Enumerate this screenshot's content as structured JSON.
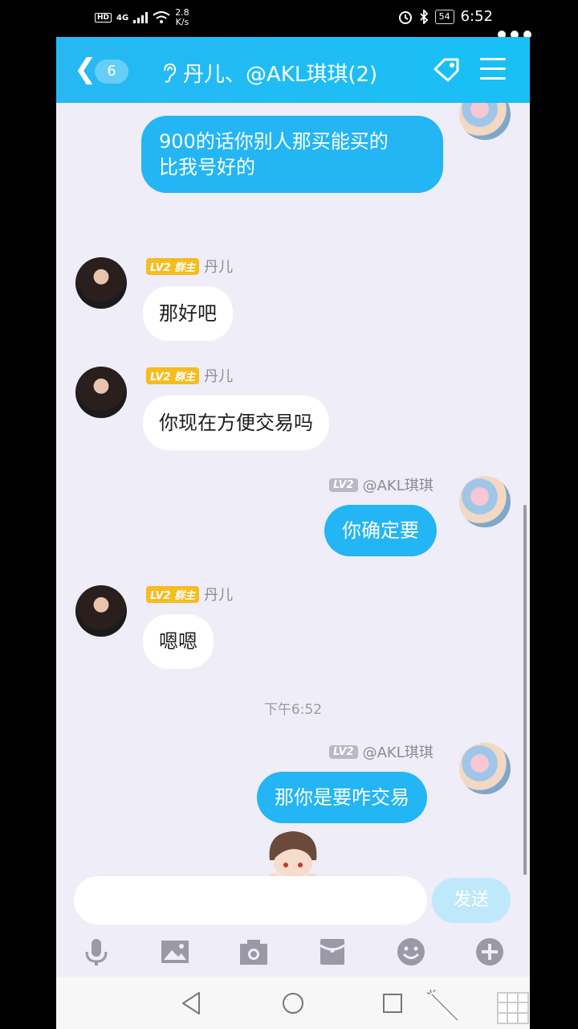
{
  "status_bar": {
    "hd": "HD",
    "network": "4G",
    "speed_value": "2.8",
    "speed_unit": "K/s",
    "battery": "54",
    "time": "6:52"
  },
  "header": {
    "back_count": "6",
    "title": "丹儿、@AKL琪琪(2)"
  },
  "messages": [
    {
      "side": "out",
      "text_lines": [
        "900的话你别人那买能买的",
        "比我号好的"
      ]
    },
    {
      "side": "in",
      "level": "LV2",
      "role": "群主",
      "name": "丹儿",
      "text": "那好吧"
    },
    {
      "side": "in",
      "level": "LV2",
      "role": "群主",
      "name": "丹儿",
      "text": "你现在方便交易吗"
    },
    {
      "side": "out",
      "level": "LV2",
      "name": "@AKL琪琪",
      "text": "你确定要"
    },
    {
      "side": "in",
      "level": "LV2",
      "role": "群主",
      "name": "丹儿",
      "text": "嗯嗯"
    },
    {
      "side": "out",
      "level": "LV2",
      "name": "@AKL琪琪",
      "text": "那你是要咋交易"
    }
  ],
  "timestamp": "下午6:52",
  "composer": {
    "input_value": "",
    "send_label": "发送"
  },
  "toolbar_icons": [
    "microphone-icon",
    "image-icon",
    "camera-icon",
    "red-packet-icon",
    "emoji-icon",
    "plus-icon"
  ],
  "colors": {
    "accent": "#23b5f4",
    "header": "#1fbcf4",
    "chat_bg": "#efedf7",
    "level_badge": "#f6bc21"
  }
}
